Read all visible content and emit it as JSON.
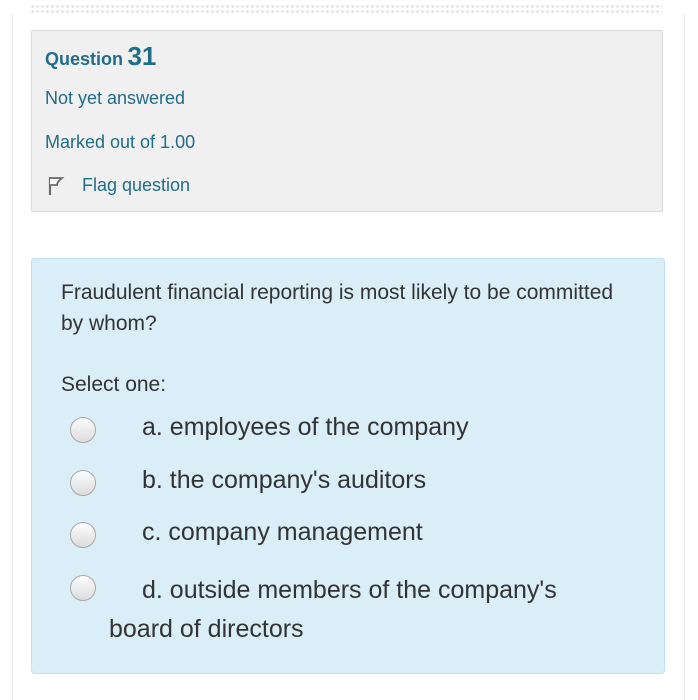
{
  "question_info": {
    "title_prefix": "Question",
    "number": "31",
    "state": "Not yet answered",
    "grade": "Marked out of 1.00",
    "flag_label": "Flag question"
  },
  "question": {
    "text": "Fraudulent financial reporting is most likely to be committed by whom?",
    "prompt": "Select one:",
    "options": [
      {
        "label": "a. employees of the company"
      },
      {
        "label": "b. the company's auditors"
      },
      {
        "label": "c. company management"
      },
      {
        "label_line1": "d. outside members of the company's",
        "label_line2": "board of directors"
      }
    ]
  },
  "colors": {
    "link": "#1f6d8a",
    "info_background": "#f0f0f0",
    "question_background": "#daeef7",
    "text": "#333333"
  },
  "icons": {
    "flag": "flag-icon",
    "radio": "radio-unchecked"
  }
}
